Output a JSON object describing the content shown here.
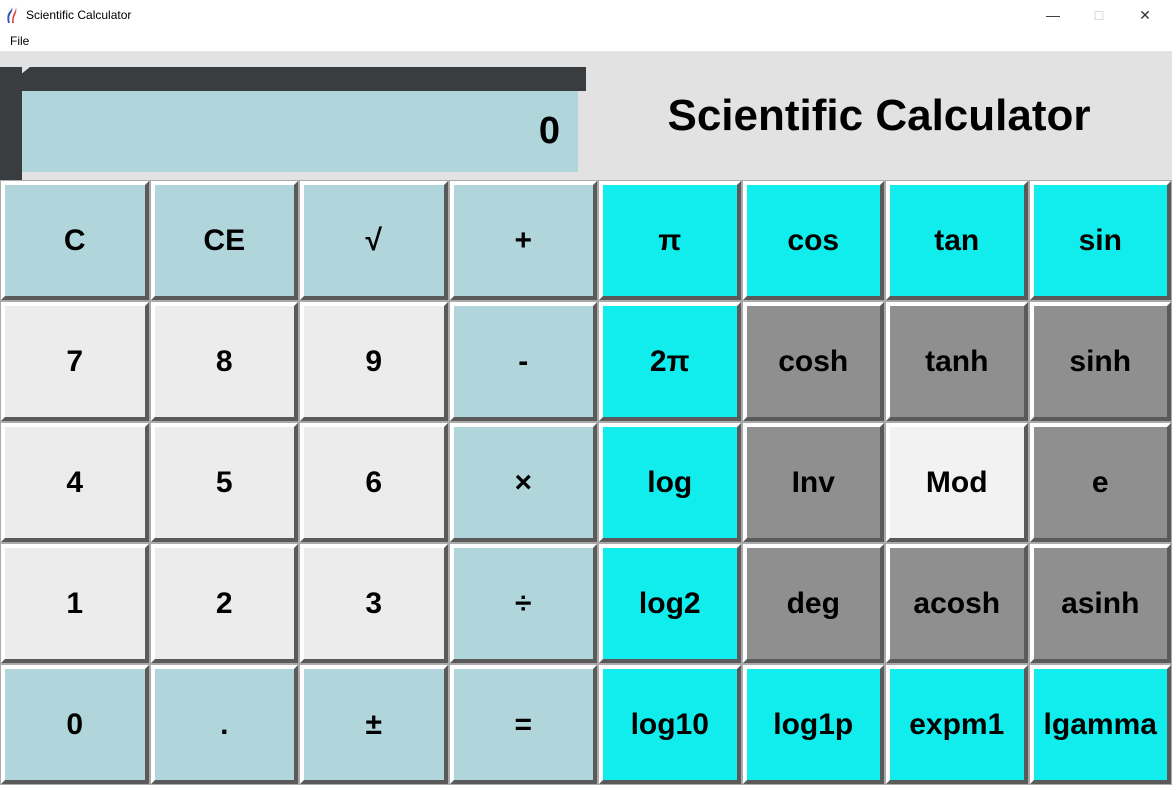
{
  "window": {
    "title": "Scientific Calculator"
  },
  "menu": {
    "file": "File"
  },
  "display": {
    "value": "0"
  },
  "heading": "Scientific Calculator",
  "btns": {
    "c": "C",
    "ce": "CE",
    "sqrt": "√",
    "plus": "+",
    "7": "7",
    "8": "8",
    "9": "9",
    "minus": "-",
    "4": "4",
    "5": "5",
    "6": "6",
    "mult": "×",
    "1": "1",
    "2": "2",
    "3": "3",
    "div": "÷",
    "0": "0",
    "dot": ".",
    "pm": "±",
    "eq": "=",
    "pi": "π",
    "cos": "cos",
    "tan": "tan",
    "sin": "sin",
    "2pi": "2π",
    "cosh": "cosh",
    "tanh": "tanh",
    "sinh": "sinh",
    "log": "log",
    "inv": "Inv",
    "mod": "Mod",
    "e": "e",
    "log2": "log2",
    "deg": "deg",
    "acosh": "acosh",
    "asinh": "asinh",
    "log10": "log10",
    "log1p": "log1p",
    "expm1": "expm1",
    "lgamma": "lgamma"
  }
}
